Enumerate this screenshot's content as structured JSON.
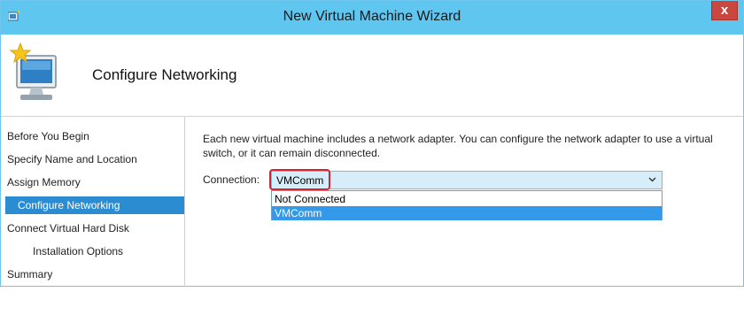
{
  "window": {
    "title": "New Virtual Machine Wizard",
    "close_label": "x"
  },
  "header": {
    "page_title": "Configure Networking"
  },
  "nav": {
    "items": [
      {
        "label": "Before You Begin"
      },
      {
        "label": "Specify Name and Location"
      },
      {
        "label": "Assign Memory"
      },
      {
        "label": "Configure Networking",
        "active": true
      },
      {
        "label": "Connect Virtual Hard Disk"
      },
      {
        "label": "Installation Options"
      },
      {
        "label": "Summary"
      }
    ]
  },
  "main": {
    "description": "Each new virtual machine includes a network adapter. You can configure the network adapter to use a virtual switch, or it can remain disconnected.",
    "connection_label": "Connection:",
    "connection_value": "VMComm",
    "options": [
      "Not Connected",
      "VMComm"
    ],
    "selected_option": "VMComm"
  },
  "colors": {
    "titlebar": "#5fc6f0",
    "nav_active": "#2b8cd2",
    "highlight_box": "#d8242f",
    "dropdown_selected": "#3399e8"
  },
  "icons": {
    "app": "app-icon",
    "wizard": "monitor-star-icon",
    "close": "close-icon",
    "dropdown": "chevron-down-icon"
  }
}
